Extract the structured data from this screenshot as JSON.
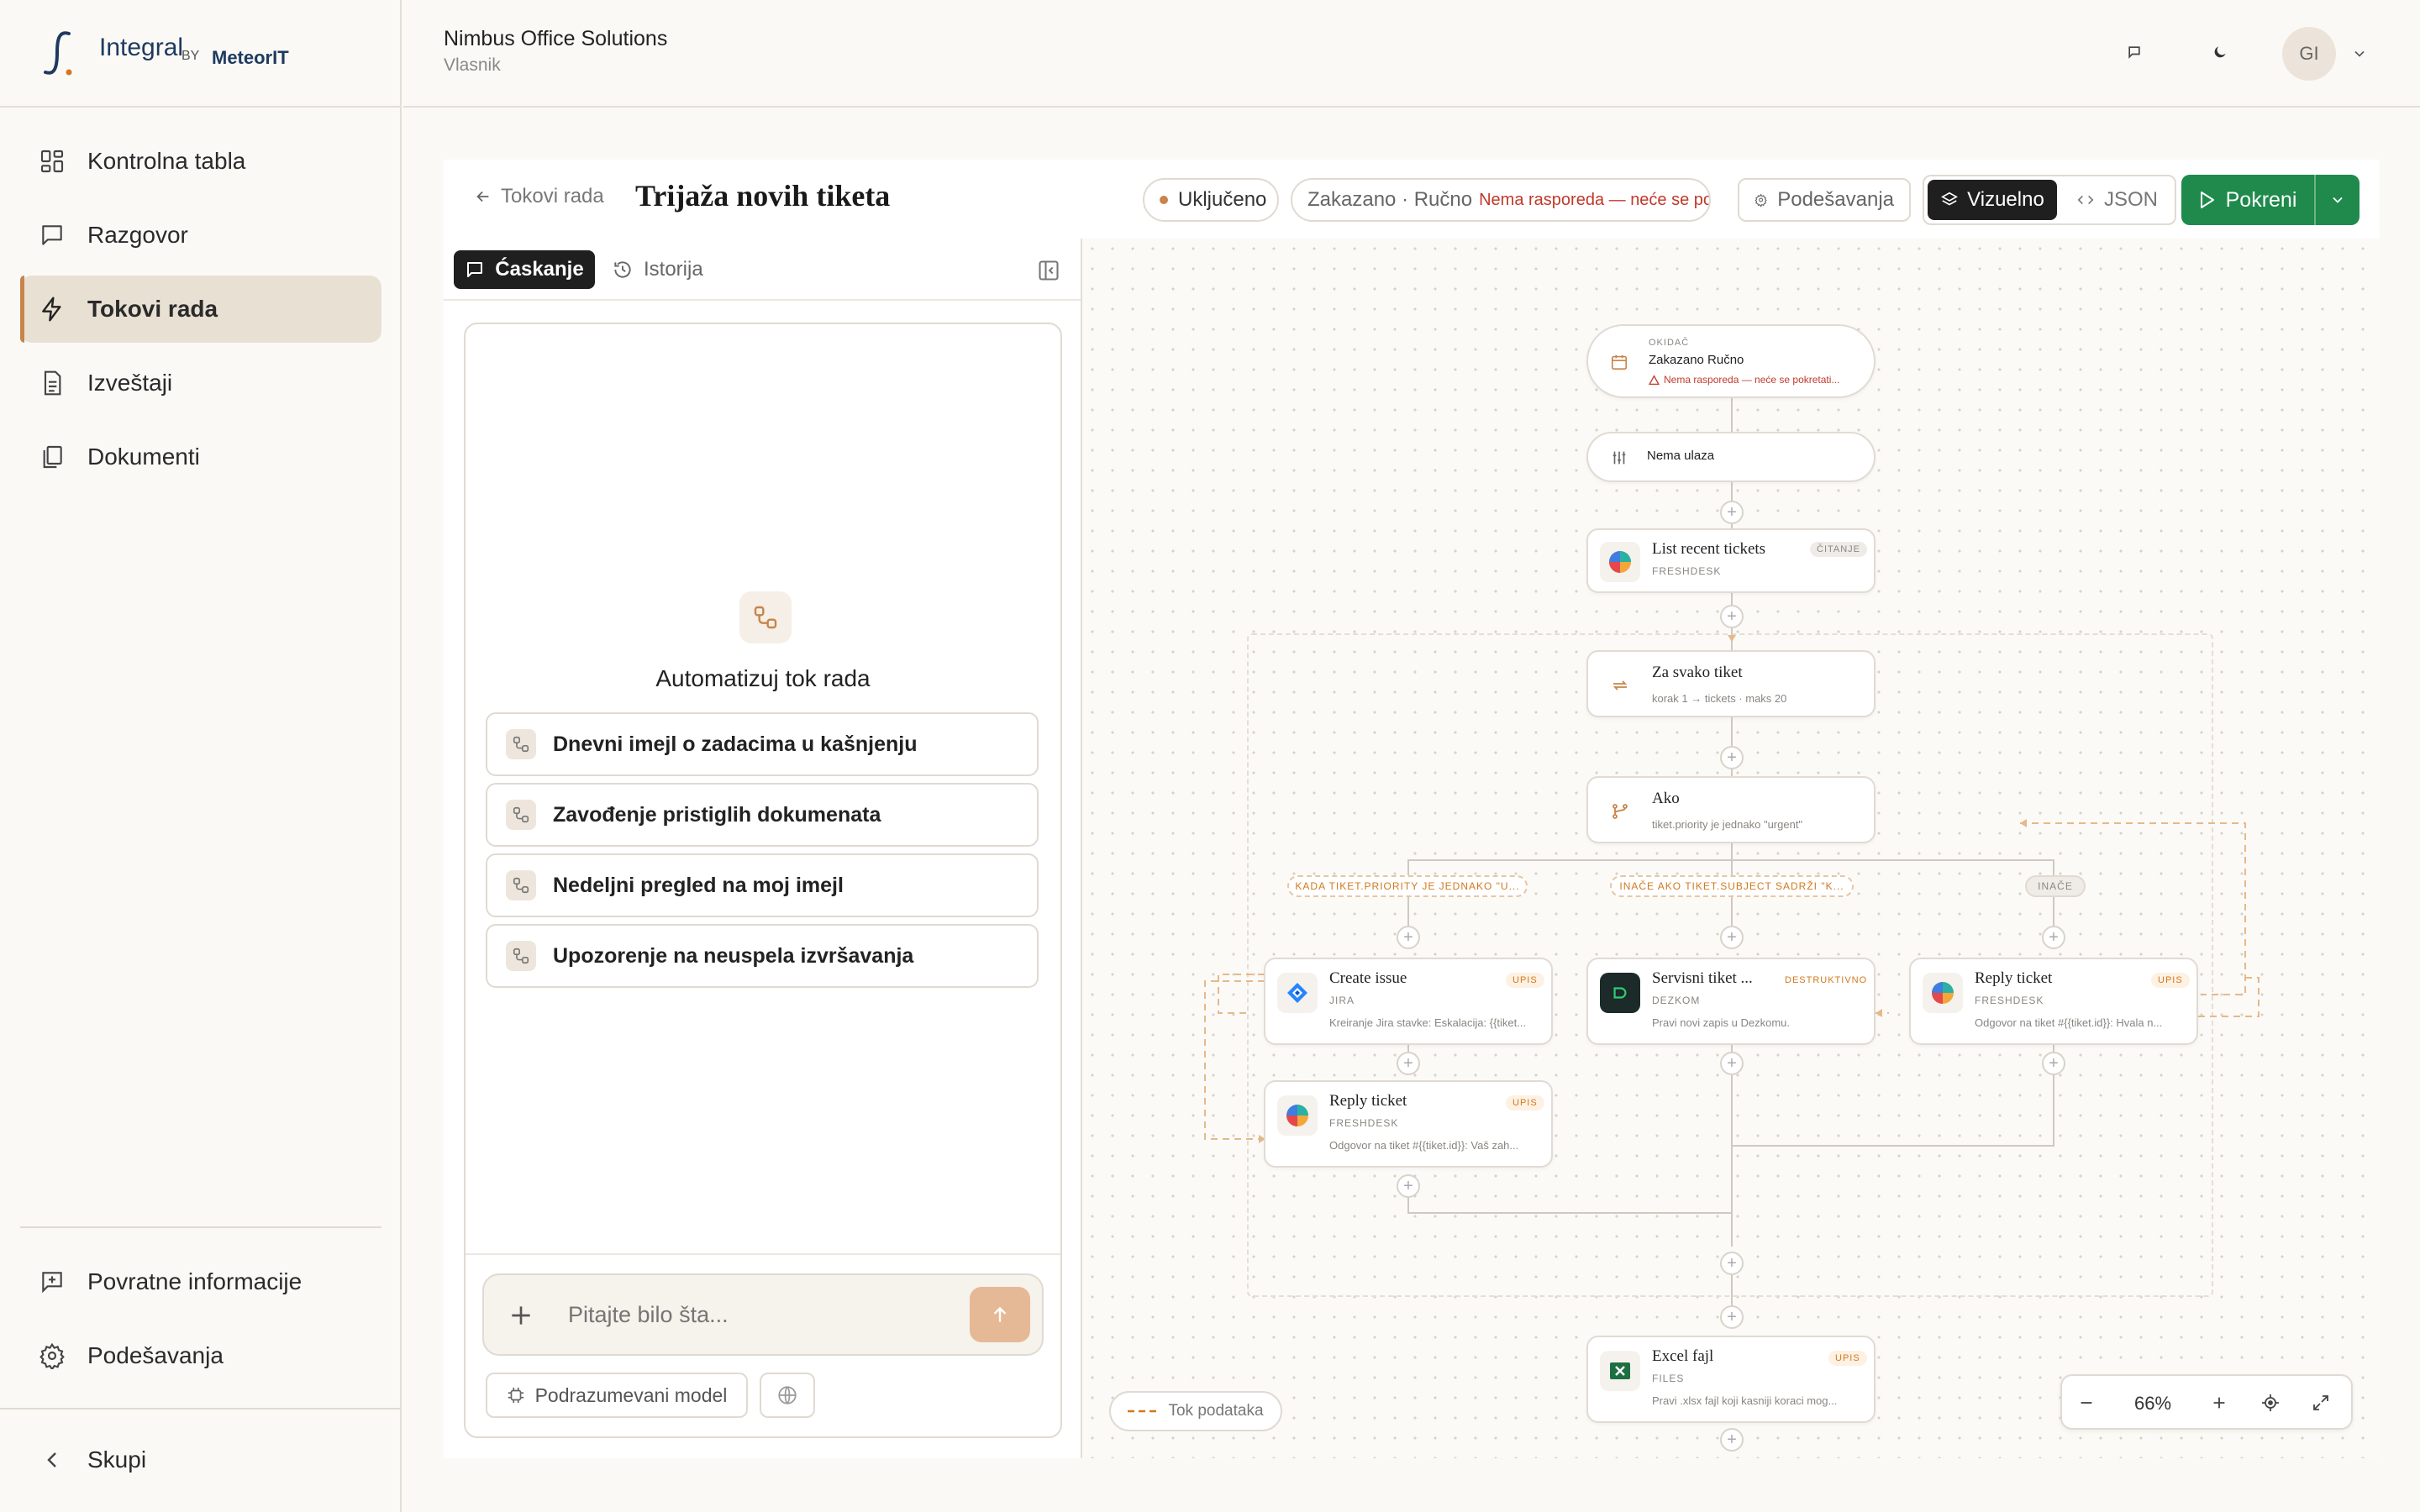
{
  "brand": {
    "name": "Integral",
    "by": "BY",
    "partner": "MeteorIT"
  },
  "org": {
    "name": "Nimbus Office Solutions",
    "role": "Vlasnik"
  },
  "user": {
    "initials": "GI"
  },
  "sidebar": {
    "items": [
      {
        "label": "Kontrolna tabla",
        "icon": "dashboard-icon"
      },
      {
        "label": "Razgovor",
        "icon": "chat-icon"
      },
      {
        "label": "Tokovi rada",
        "icon": "lightning-icon",
        "active": true
      },
      {
        "label": "Izveštaji",
        "icon": "report-icon"
      },
      {
        "label": "Dokumenti",
        "icon": "documents-icon"
      }
    ],
    "bottom": [
      {
        "label": "Povratne informacije",
        "icon": "feedback-icon"
      },
      {
        "label": "Podešavanja",
        "icon": "gear-icon"
      }
    ],
    "collapse_label": "Skupi"
  },
  "workflow": {
    "back_label": "Tokovi rada",
    "title": "Trijaža novih tiketa",
    "status": "Uključeno",
    "schedule_label": "Zakazano · Ručno",
    "schedule_warning": "Nema rasporeda — neće se po...",
    "settings_label": "Podešavanja",
    "view_visual": "Vizuelno",
    "view_json": "JSON",
    "run_label": "Pokreni"
  },
  "panel": {
    "tab_chat": "Ćaskanje",
    "tab_history": "Istorija",
    "empty_title": "Automatizuj tok rada",
    "suggestions": [
      "Dnevni imejl o zadacima u kašnjenju",
      "Zavođenje pristiglih dokumenata",
      "Nedeljni pregled na moj imejl",
      "Upozorenje na neuspela izvršavanja"
    ],
    "input_placeholder": "Pitajte bilo šta...",
    "model_label": "Podrazumevani model"
  },
  "canvas": {
    "trigger": {
      "kicker": "OKIDAČ",
      "title": "Zakazano Ručno",
      "warning": "Nema rasporeda — neće se pokretati..."
    },
    "input": {
      "title": "Nema ulaza"
    },
    "list": {
      "title": "List recent tickets",
      "app": "FRESHDESK",
      "badge": "ČITANJE"
    },
    "loop": {
      "title": "Za svako tiket",
      "desc": "korak 1 → tickets · maks 20"
    },
    "cond": {
      "title": "Ako",
      "desc": "tiket.priority je jednako \"urgent\""
    },
    "branches": [
      "KADA TIKET.PRIORITY JE JEDNAKO \"U...",
      "INAČE AKO TIKET.SUBJECT SADRŽI \"K...",
      "INAČE"
    ],
    "jira": {
      "title": "Create issue",
      "app": "JIRA",
      "badge": "UPIS",
      "desc": "Kreiranje Jira stavke: Eskalacija: {{tiket..."
    },
    "service": {
      "title": "Servisni tiket ...",
      "app": "DEZKOM",
      "badge": "DESTRUKTIVNO",
      "desc": "Pravi novi zapis u Dezkomu."
    },
    "reply_right": {
      "title": "Reply ticket",
      "app": "FRESHDESK",
      "badge": "UPIS",
      "desc": "Odgovor na tiket #{{tiket.id}}: Hvala n..."
    },
    "reply_left": {
      "title": "Reply ticket",
      "app": "FRESHDESK",
      "badge": "UPIS",
      "desc": "Odgovor na tiket #{{tiket.id}}: Vaš zah..."
    },
    "excel": {
      "title": "Excel fajl",
      "app": "FILES",
      "badge": "UPIS",
      "desc": "Pravi .xlsx fajl koji kasniji koraci mog..."
    },
    "legend_label": "Tok podataka",
    "zoom": "66%"
  },
  "colors": {
    "accent": "#c8844a",
    "run_green": "#1f8a4c",
    "warning_red": "#c0392b"
  }
}
